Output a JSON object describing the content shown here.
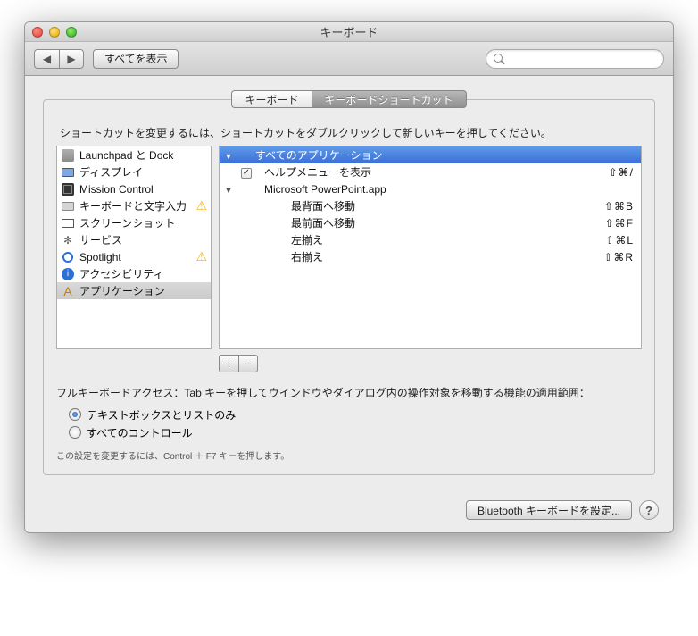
{
  "window": {
    "title": "キーボード"
  },
  "toolbar": {
    "show_all": "すべてを表示",
    "search_placeholder": ""
  },
  "tabs": {
    "keyboard": "キーボード",
    "shortcuts": "キーボードショートカット"
  },
  "instruction": "ショートカットを変更するには、ショートカットをダブルクリックして新しいキーを押してください。",
  "categories": [
    {
      "label": "Launchpad と Dock",
      "icon": "launchpad",
      "warn": false
    },
    {
      "label": "ディスプレイ",
      "icon": "display",
      "warn": false
    },
    {
      "label": "Mission Control",
      "icon": "mission",
      "warn": false
    },
    {
      "label": "キーボードと文字入力",
      "icon": "keyboard",
      "warn": true
    },
    {
      "label": "スクリーンショット",
      "icon": "screenshot",
      "warn": false
    },
    {
      "label": "サービス",
      "icon": "gear",
      "warn": false
    },
    {
      "label": "Spotlight",
      "icon": "spotlight",
      "warn": true
    },
    {
      "label": "アクセシビリティ",
      "icon": "accessibility",
      "warn": false
    },
    {
      "label": "アプリケーション",
      "icon": "app",
      "warn": false
    }
  ],
  "selected_category_index": 8,
  "shortcuts": {
    "group_label": "すべてのアプリケーション",
    "items": [
      {
        "label": "ヘルプメニューを表示",
        "keys": "⇧⌘/",
        "checked": true
      }
    ],
    "subgroup_label": "Microsoft PowerPoint.app",
    "subitems": [
      {
        "label": "最背面へ移動",
        "keys": "⇧⌘B"
      },
      {
        "label": "最前面へ移動",
        "keys": "⇧⌘F"
      },
      {
        "label": "左揃え",
        "keys": "⇧⌘L"
      },
      {
        "label": "右揃え",
        "keys": "⇧⌘R"
      }
    ]
  },
  "fka": {
    "label": "フルキーボードアクセス：Tab キーを押してウインドウやダイアログ内の操作対象を移動する機能の適用範囲：",
    "opt1": "テキストボックスとリストのみ",
    "opt2": "すべてのコントロール",
    "hint": "この設定を変更するには、Control ＋ F7 キーを押します。"
  },
  "footer": {
    "bluetooth": "Bluetooth キーボードを設定..."
  }
}
